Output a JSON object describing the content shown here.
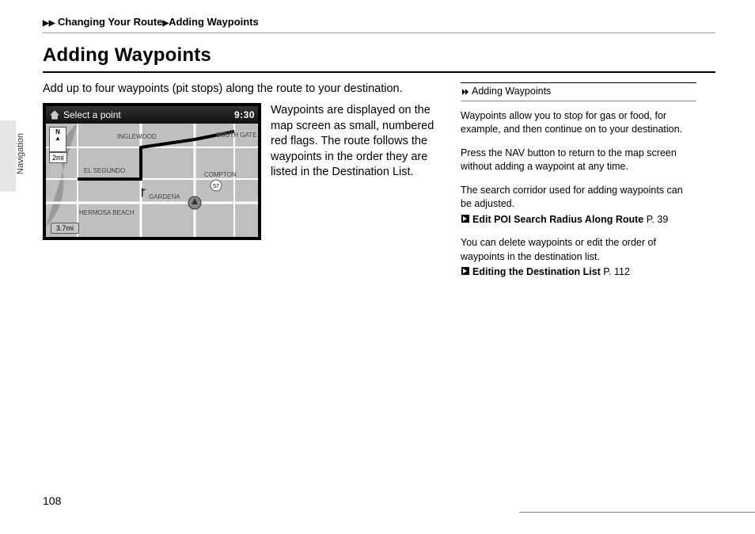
{
  "breadcrumb": {
    "level1": "Changing Your Route",
    "level2": "Adding Waypoints"
  },
  "heading": "Adding Waypoints",
  "intro": "Add up to four waypoints (pit stops) along the route to your destination.",
  "map": {
    "title": "Select a point",
    "time": "9:30",
    "compass_dir": "N",
    "compass_arrow": "▲",
    "scale_top": "2mi",
    "scale_bottom": "3.7mi",
    "labels": {
      "inglewood": "INGLEWOOD",
      "elsegundo": "EL SEGUNDO",
      "gardena": "GARDENA",
      "compton": "COMPTON",
      "southgate": "SOUTH GATE",
      "hermosa": "HERMOSA BEACH"
    }
  },
  "caption": "Waypoints are displayed on the map screen as small, numbered red flags. The route follows the waypoints in the order they are listed in the Destination List.",
  "sidebar": {
    "header": "Adding Waypoints",
    "p1": "Waypoints allow you to stop for gas or food, for example, and then continue on to your destination.",
    "p2": "Press the NAV button to return to the map screen without adding a waypoint at any time.",
    "p3": "The search corridor used for adding waypoints can be adjusted.",
    "ref1_title": "Edit POI Search Radius Along Route",
    "ref1_page": "P. 39",
    "p4": "You can delete waypoints or edit the order of waypoints in the destination list.",
    "ref2_title": "Editing the Destination List",
    "ref2_page": "P. 112"
  },
  "side_tab": "Navigation",
  "page_number": "108"
}
